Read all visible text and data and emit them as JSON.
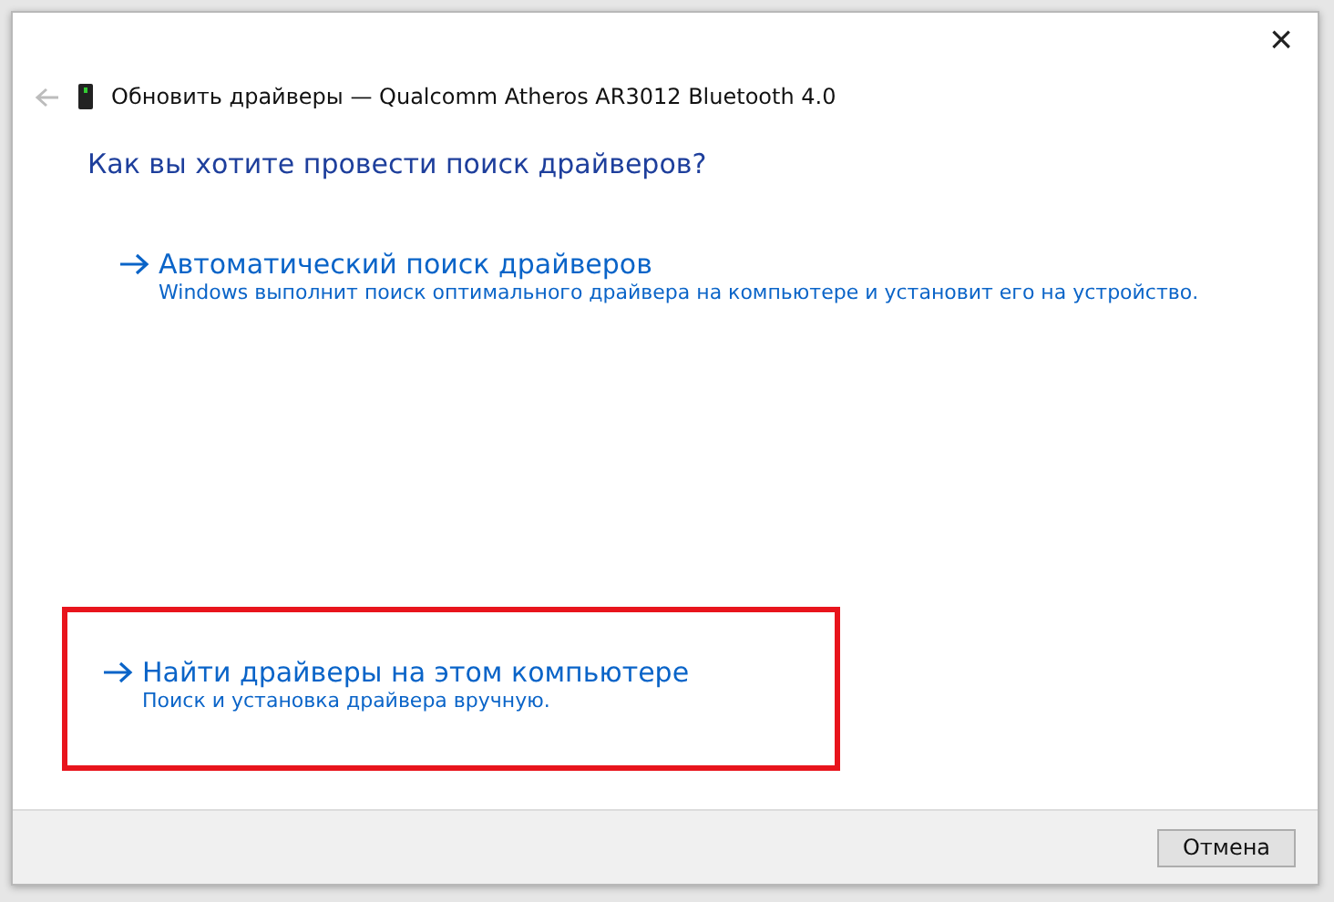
{
  "window": {
    "title": "Обновить драйверы — Qualcomm Atheros AR3012 Bluetooth 4.0",
    "close": "×"
  },
  "heading": "Как вы хотите провести поиск драйверов?",
  "options": [
    {
      "title": "Автоматический поиск драйверов",
      "description": "Windows выполнит поиск оптимального драйвера на компьютере и установит его на устройство.",
      "highlighted": false
    },
    {
      "title": "Найти драйверы на этом компьютере",
      "description": "Поиск и установка драйвера вручную.",
      "highlighted": true
    }
  ],
  "buttons": [
    "Отмена"
  ]
}
